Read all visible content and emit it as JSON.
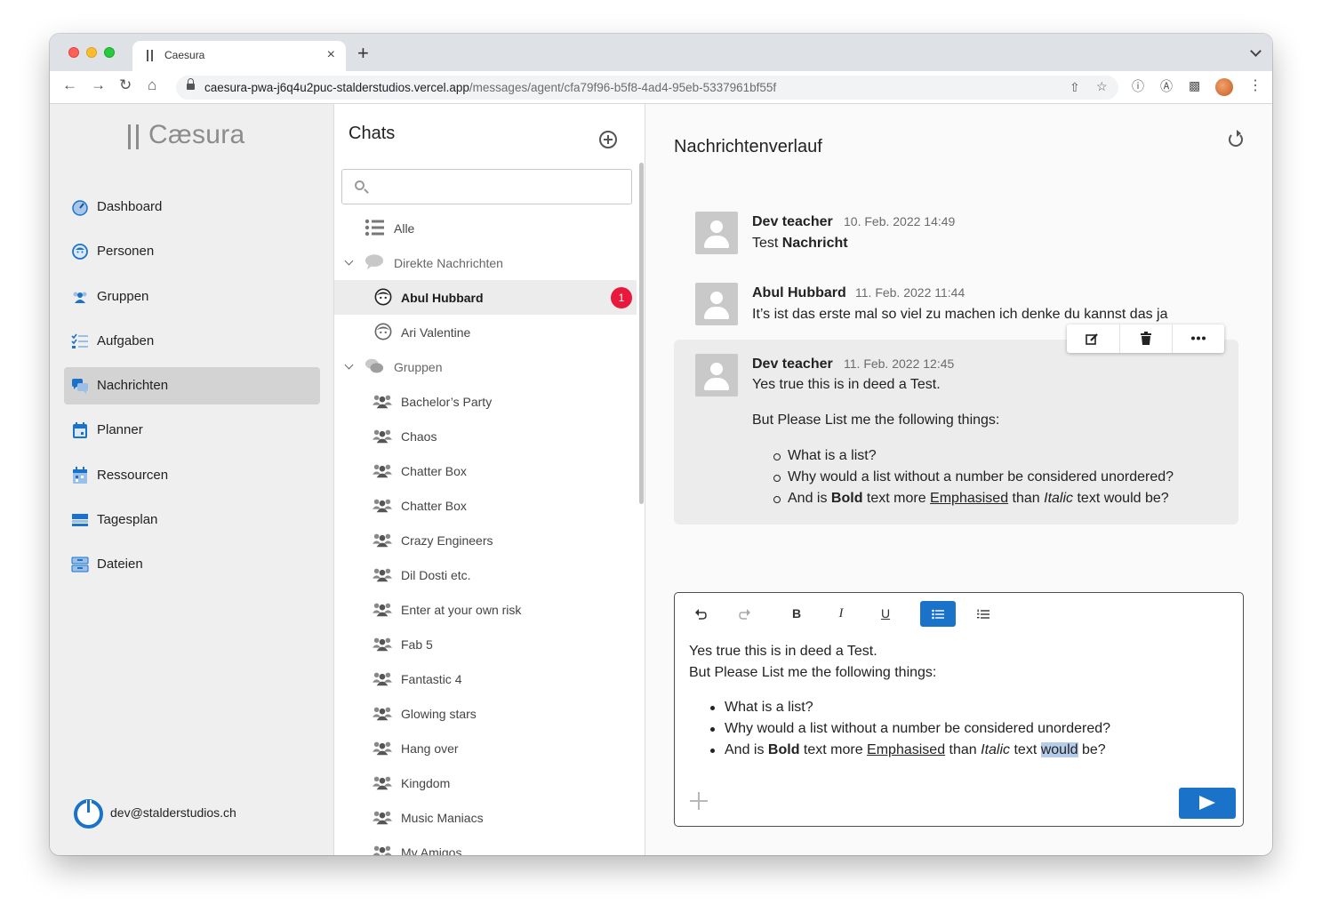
{
  "browser": {
    "tab_title": "Caesura",
    "tab_close": "×",
    "new_tab": "+",
    "url_host": "caesura-pwa-j6q4u2puc-stalderstudios.vercel.app",
    "url_path": "/messages/agent/cfa79f96-b5f8-4ad4-95eb-5337961bf55f"
  },
  "app": {
    "logo": "Cæsura"
  },
  "sidebar": {
    "items": [
      {
        "label": "Dashboard",
        "icon": "dashboard-icon"
      },
      {
        "label": "Personen",
        "icon": "person-icon"
      },
      {
        "label": "Gruppen",
        "icon": "group-icon"
      },
      {
        "label": "Aufgaben",
        "icon": "tasks-icon"
      },
      {
        "label": "Nachrichten",
        "icon": "messages-icon",
        "active": true
      },
      {
        "label": "Planner",
        "icon": "planner-icon"
      },
      {
        "label": "Ressourcen",
        "icon": "resources-icon"
      },
      {
        "label": "Tagesplan",
        "icon": "dayplan-icon"
      },
      {
        "label": "Dateien",
        "icon": "files-icon"
      }
    ],
    "user_email": "dev@stalderstudios.ch"
  },
  "chats": {
    "title": "Chats",
    "search_placeholder": "",
    "all_label": "Alle",
    "direct_label": "Direkte Nachrichten",
    "direct": [
      {
        "name": "Abul Hubbard",
        "unread": "1",
        "active": true
      },
      {
        "name": "Ari Valentine"
      }
    ],
    "groups_label": "Gruppen",
    "groups": [
      "Bachelor’s Party",
      "Chaos",
      "Chatter Box",
      "Chatter Box",
      "Crazy Engineers",
      "Dil Dosti etc.",
      "Enter at your own risk",
      "Fab 5",
      "Fantastic 4",
      "Glowing stars",
      "Hang over",
      "Kingdom",
      "Music Maniacs",
      "My Amigos"
    ]
  },
  "main": {
    "title": "Nachrichtenverlauf",
    "messages": [
      {
        "author": "Dev teacher",
        "date": "10. Feb. 2022 14:49",
        "text_a": "Test ",
        "text_b": "Nachricht"
      },
      {
        "author": "Abul Hubbard",
        "date": "11. Feb. 2022 11:44",
        "text": "It’s ist das erste mal so viel zu machen ich denke du kannst das ja"
      },
      {
        "author": "Dev teacher",
        "date": "11. Feb. 2022 12:45",
        "line1": "Yes true this is in deed a Test.",
        "line2": "But Please List me the following things:",
        "list": [
          "What is a list?",
          "Why would a list without a number be considered unordered?"
        ],
        "l3_a": "And is ",
        "l3_bold": "Bold",
        "l3_b": " text more ",
        "l3_under": "Emphasised",
        "l3_c": " than ",
        "l3_italic": "Italic",
        "l3_d": " text would be?"
      }
    ],
    "editor": {
      "line1": "Yes true this is in deed a Test.",
      "line2": "But Please List me the following things:",
      "list": [
        "What is a list?",
        "Why would a list without a number be considered unordered?"
      ],
      "l3_a": "And is ",
      "l3_bold": "Bold",
      "l3_b": " text more ",
      "l3_under": "Emphasised",
      "l3_c": " than ",
      "l3_italic": "Italic",
      "l3_d": " text ",
      "l3_sel": "would",
      "l3_e": " be?",
      "toolbar": {
        "bold": "B",
        "italic": "I",
        "underline": "U"
      }
    }
  },
  "colors": {
    "accent": "#1a73c8",
    "badge": "#e8193c",
    "sidebar_bg": "#efefef",
    "active_nav": "#d3d3d3"
  }
}
